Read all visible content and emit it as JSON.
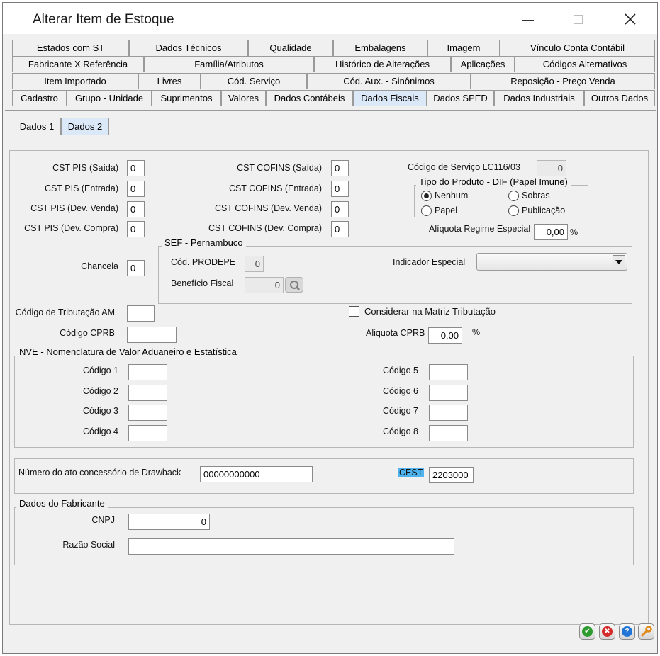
{
  "window": {
    "title": "Alterar Item de Estoque"
  },
  "tabs": {
    "row1": [
      "Estados com ST",
      "Dados Técnicos",
      "Qualidade",
      "Embalagens",
      "Imagem",
      "Vínculo Conta Contábil"
    ],
    "row2": [
      "Fabricante X Referência",
      "Família/Atributos",
      "Histórico de Alterações",
      "Aplicações",
      "Códigos Alternativos"
    ],
    "row3": [
      "Item Importado",
      "Livres",
      "Cód. Serviço",
      "Cód. Aux. - Sinônimos",
      "Reposição - Preço Venda"
    ],
    "row4": [
      "Cadastro",
      "Grupo - Unidade",
      "Suprimentos",
      "Valores",
      "Dados Contábeis",
      "Dados Fiscais",
      "Dados SPED",
      "Dados Industriais",
      "Outros Dados"
    ]
  },
  "subtabs": [
    "Dados 1",
    "Dados 2"
  ],
  "pis": {
    "saida_label": "CST PIS (Saída)",
    "saida": "0",
    "entrada_label": "CST PIS (Entrada)",
    "entrada": "0",
    "dev_venda_label": "CST PIS (Dev. Venda)",
    "dev_venda": "0",
    "dev_compra_label": "CST PIS (Dev. Compra)",
    "dev_compra": "0"
  },
  "cofins": {
    "saida_label": "CST COFINS (Saída)",
    "saida": "0",
    "entrada_label": "CST COFINS (Entrada)",
    "entrada": "0",
    "dev_venda_label": "CST COFINS (Dev. Venda)",
    "dev_venda": "0",
    "dev_compra_label": "CST COFINS (Dev. Compra)",
    "dev_compra": "0"
  },
  "servico": {
    "label": "Código de Serviço LC116/03",
    "value": "0"
  },
  "tipo_produto": {
    "title": "Tipo do Produto - DIF (Papel Imune)",
    "options": [
      "Nenhum",
      "Sobras",
      "Papel",
      "Publicação"
    ],
    "selected": "Nenhum"
  },
  "aliquota_regime": {
    "label": "Alíquota Regime Especial",
    "value": "0,00",
    "unit": "%"
  },
  "chancela": {
    "label": "Chancela",
    "value": "0"
  },
  "sef": {
    "title": "SEF - Pernambuco",
    "prodepe_label": "Cód. PRODEPE",
    "prodepe": "0",
    "beneficio_label": "Benefício Fiscal",
    "beneficio": "0",
    "indicador_label": "Indicador Especial",
    "indicador": ""
  },
  "tributacao_am": {
    "label": "Código de Tributação AM",
    "value": ""
  },
  "cprb": {
    "label": "Código CPRB",
    "value": ""
  },
  "matriz": {
    "label": "Considerar na Matriz Tributação",
    "checked": false
  },
  "aliquota_cprb": {
    "label": "Aliquota CPRB",
    "value": "0,00",
    "unit": "%"
  },
  "nve": {
    "title": "NVE - Nomenclatura de Valor Aduaneiro e Estatística",
    "labels": [
      "Código 1",
      "Código 2",
      "Código 3",
      "Código 4",
      "Código 5",
      "Código 6",
      "Código 7",
      "Código 8"
    ],
    "values": [
      "",
      "",
      "",
      "",
      "",
      "",
      "",
      ""
    ]
  },
  "drawback": {
    "label": "Número do ato concessório de Drawback",
    "value": "00000000000"
  },
  "cest": {
    "label": "CEST",
    "value": "2203000"
  },
  "fabricante": {
    "title": "Dados do Fabricante",
    "cnpj_label": "CNPJ",
    "cnpj": "0",
    "razao_label": "Razão Social",
    "razao": ""
  },
  "colors": {
    "tab_active": "#dbe8f7",
    "cest_highlight": "#4fb3ee",
    "ok": "#2e9b2e",
    "cancel": "#d42a2a",
    "help": "#1f74d6",
    "tools": "#e08a1a"
  },
  "actions": [
    "ok-icon",
    "cancel-icon",
    "help-icon",
    "wrench-icon"
  ]
}
